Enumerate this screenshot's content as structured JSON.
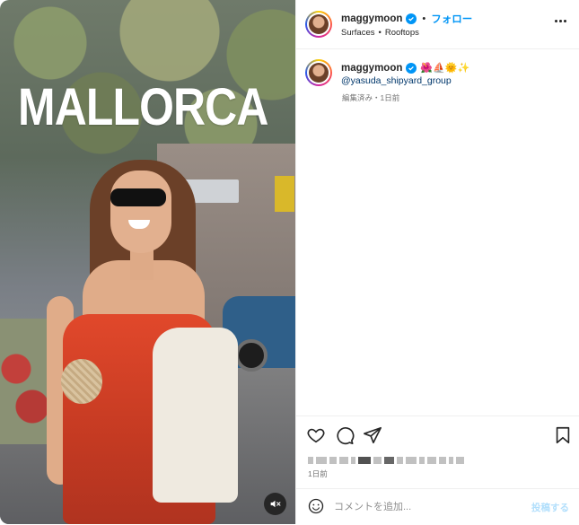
{
  "media": {
    "overlay_text": "MALLORCA",
    "mute_icon": "speaker-muted-icon"
  },
  "header": {
    "username": "maggymoon",
    "verified_icon": "verified-badge-icon",
    "separator": "•",
    "follow_label": "フォロー",
    "audio": "Surfaces",
    "audio_separator": "•",
    "audio_track": "Rooftops",
    "more_icon": "more-options-icon"
  },
  "caption": {
    "username": "maggymoon",
    "emojis": "🌺⛵🌞✨",
    "mention": "@yasuda_shipyard_group",
    "meta": "編集済み・1日前"
  },
  "actions": {
    "like_icon": "heart-icon",
    "comment_icon": "comment-icon",
    "share_icon": "share-icon",
    "save_icon": "bookmark-icon"
  },
  "post_date": "1日前",
  "composer": {
    "emoji_icon": "emoji-icon",
    "placeholder": "コメントを追加...",
    "post_label": "投稿する"
  },
  "colors": {
    "accent": "#0095f6",
    "mention": "#00376b",
    "post_disabled": "#b2dffc"
  }
}
